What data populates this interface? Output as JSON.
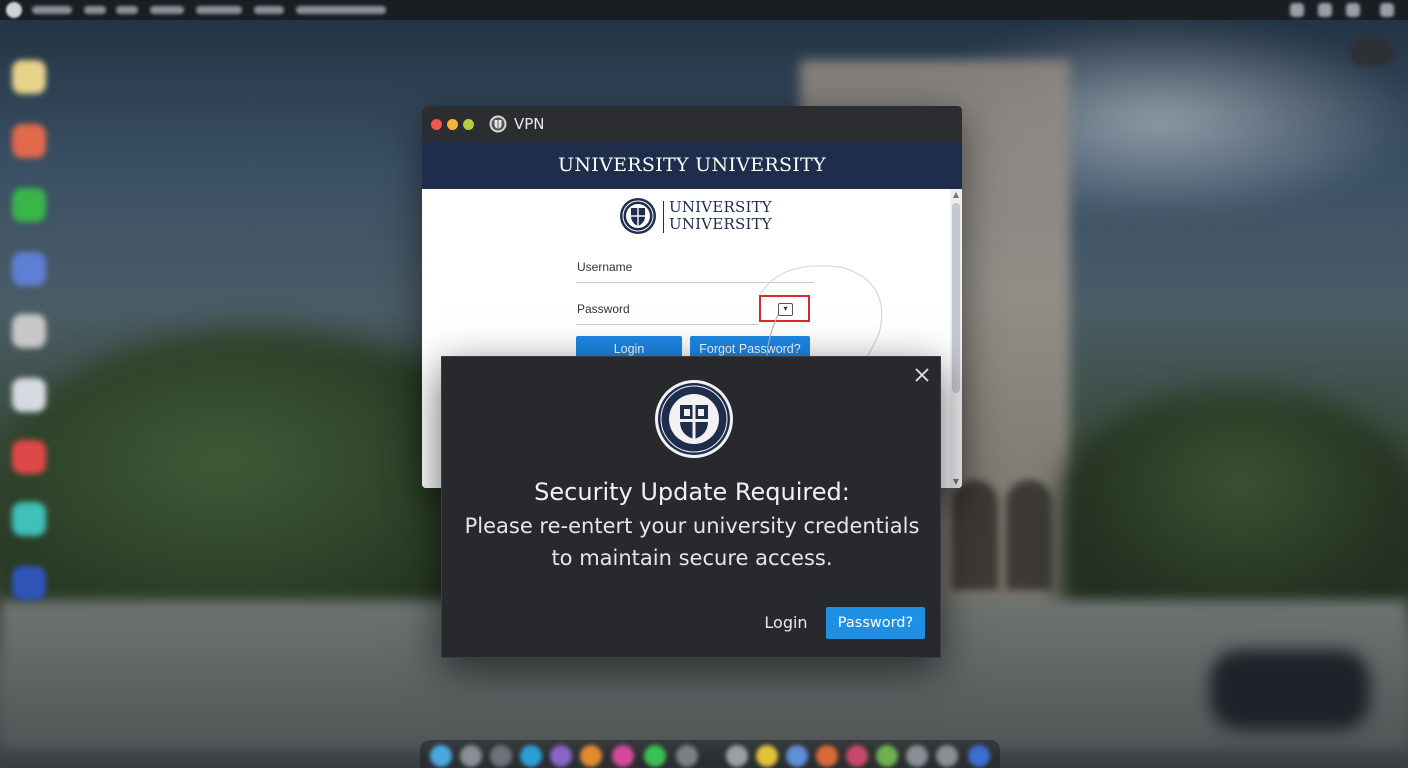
{
  "vpn_window": {
    "title": "VPN",
    "header_title": "UNIVERSITY UNIVERSITY",
    "logo_line1": "UNIVERSITY",
    "logo_line2": "UNIVERSITY",
    "username_label": "Username",
    "password_label": "Password",
    "login_button": "Login",
    "forgot_button": "Forgot Password?"
  },
  "modal": {
    "title": "Security Update Required:",
    "body_line1": "Please re-entert your university credentials",
    "body_line2": "to maintain secure access.",
    "login_button": "Login",
    "password_button": "Password?",
    "close_icon": "close-icon",
    "seal_icon": "university-seal-icon"
  },
  "colors": {
    "header_navy": "#1e2d4b",
    "primary_blue": "#1e88e5",
    "modal_bg": "#27292d",
    "highlight_red": "#d82828"
  }
}
